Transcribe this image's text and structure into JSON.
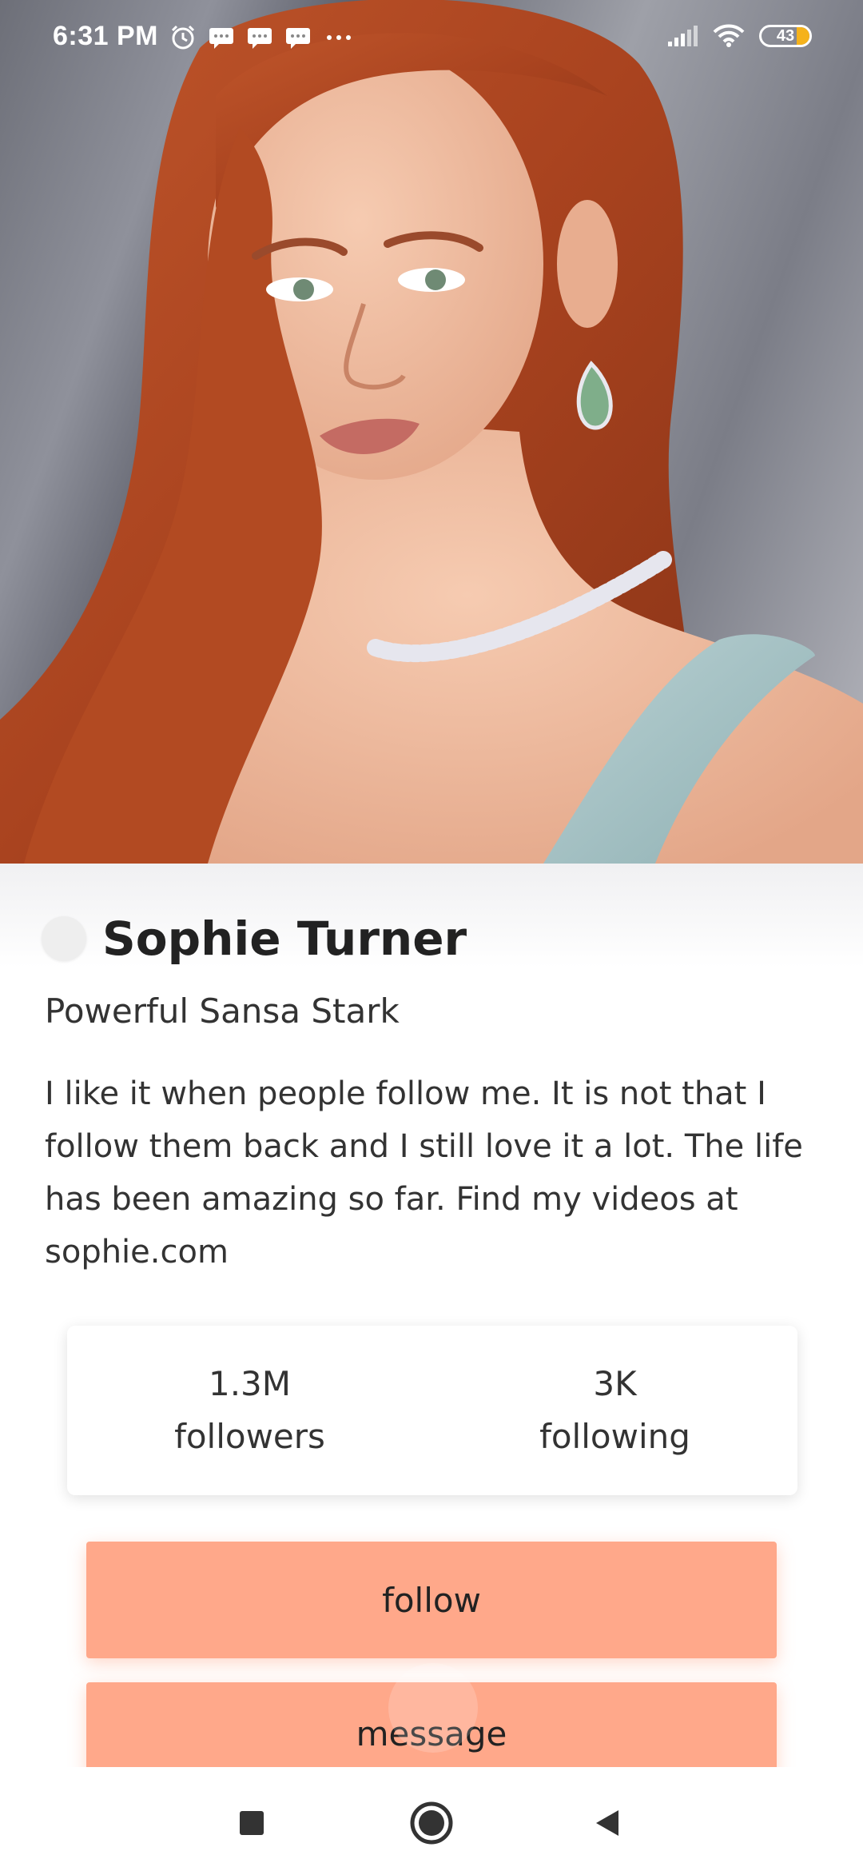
{
  "status_bar": {
    "time": "6:31 PM",
    "battery": "43",
    "left_icons": [
      "alarm-icon",
      "message-icon",
      "message-icon",
      "message-icon",
      "more-icon"
    ],
    "right_icons": [
      "signal-icon",
      "wifi-icon",
      "battery-icon"
    ]
  },
  "hero": {
    "image": "profile-photo"
  },
  "profile": {
    "name": "Sophie Turner",
    "subtitle": "Powerful Sansa Stark",
    "bio": "I like it when people follow me. It is not that I follow them back and I still love it a lot. The life has been amazing so far. Find my videos at sophie.com"
  },
  "stats": [
    {
      "value": "1.3M",
      "label": "followers"
    },
    {
      "value": "3K",
      "label": "following"
    }
  ],
  "actions": {
    "follow_label": "follow",
    "message_label": "message"
  },
  "nav": {
    "icons": [
      "recents-icon",
      "home-icon",
      "back-icon"
    ]
  },
  "colors": {
    "accent": "#ffa88a",
    "battery": "#f5b21b"
  }
}
